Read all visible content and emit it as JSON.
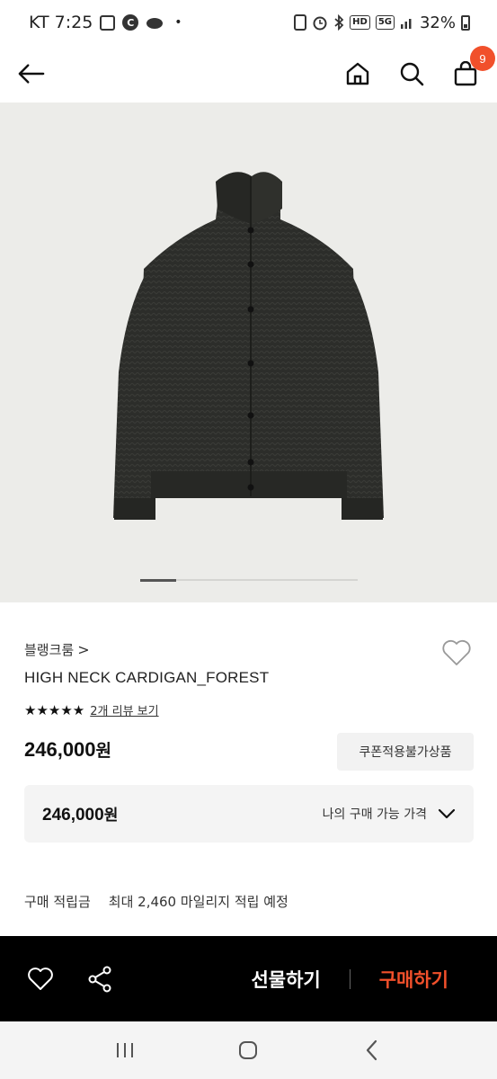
{
  "status_bar": {
    "carrier_time": "KT 7:25",
    "c_badge": "C",
    "dot": "•",
    "hd": "HD",
    "net": "5G",
    "battery": "32%"
  },
  "header": {
    "cart_count": "9"
  },
  "product": {
    "brand": "블랭크룸",
    "brand_chevron": ">",
    "name": "HIGH NECK CARDIGAN_FOREST",
    "stars": "★★★★★",
    "review_link": "2개 리뷰 보기",
    "price_value": "246,000",
    "price_unit": "원",
    "coupon_label": "쿠폰적용불가상품",
    "my_price_value": "246,000",
    "my_price_unit": "원",
    "my_price_label": "나의 구매 가능 가격",
    "points_label": "구매 적립금",
    "points_value": "최대 2,460 마일리지 적립 예정",
    "rating": 5,
    "image_index": 1
  },
  "action_bar": {
    "gift_label": "선물하기",
    "buy_label": "구매하기"
  },
  "colors": {
    "accent": "#f1502b",
    "bar_bg": "#000000"
  }
}
